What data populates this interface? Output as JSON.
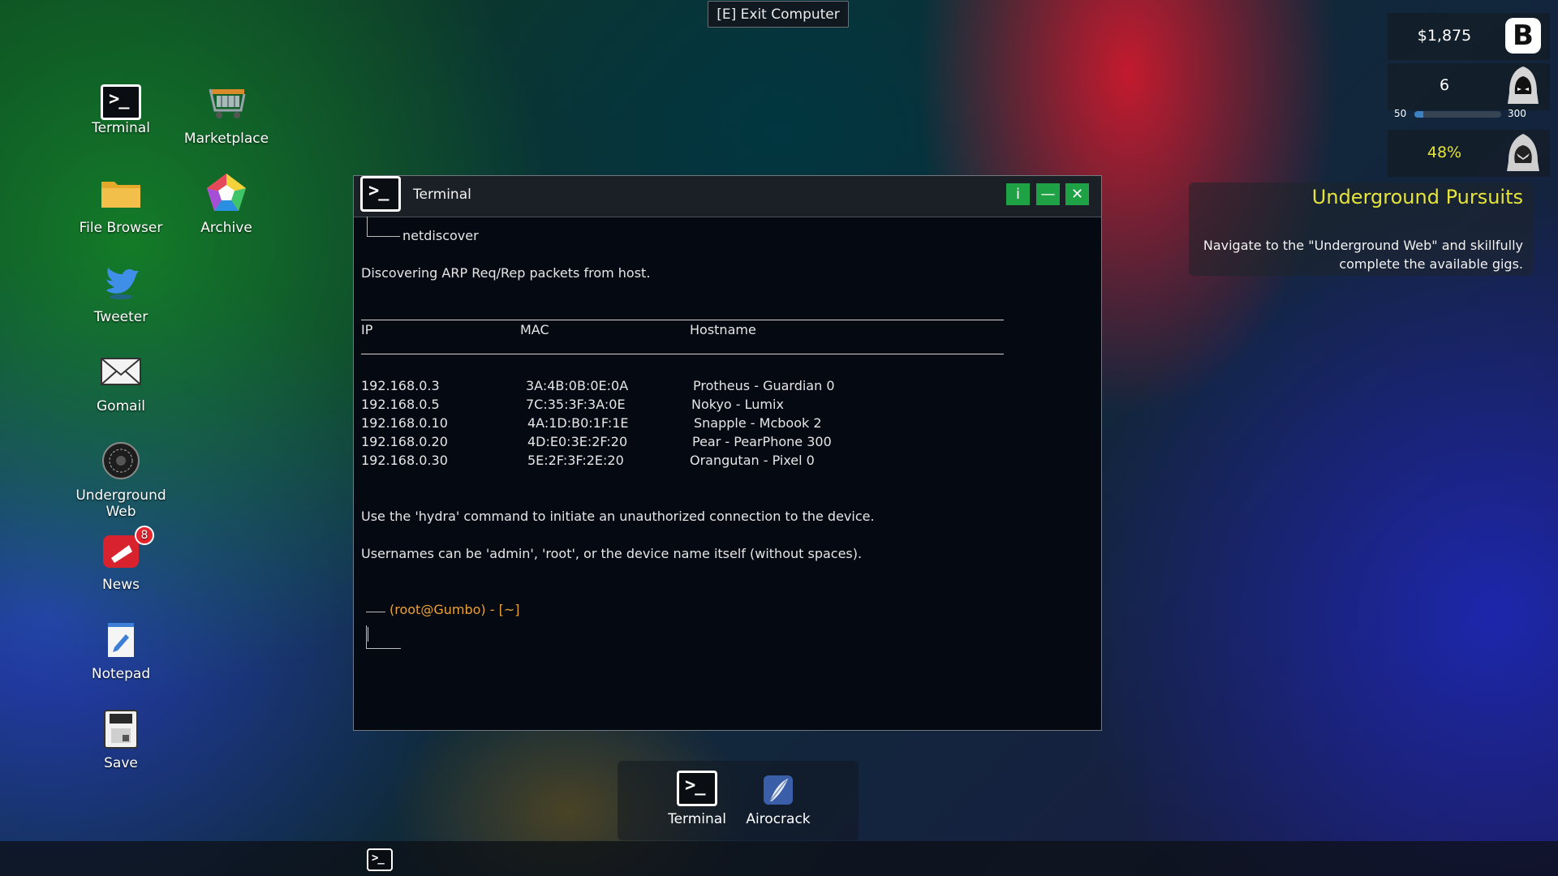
{
  "exit_hint": "[E] Exit Computer",
  "desktop": {
    "icons": [
      {
        "label": "Terminal"
      },
      {
        "label": "Marketplace"
      },
      {
        "label": "File Browser"
      },
      {
        "label": "Archive"
      },
      {
        "label": "Tweeter"
      },
      {
        "label": "Gomail"
      },
      {
        "label": "Underground Web"
      },
      {
        "label": "News",
        "badge": "8"
      },
      {
        "label": "Notepad"
      },
      {
        "label": "Save"
      }
    ]
  },
  "terminal_window": {
    "title": "Terminal",
    "buttons": {
      "info": "i",
      "minimize": "—",
      "close": "✕"
    },
    "command": "netdiscover",
    "discovering": "Discovering ARP Req/Rep packets from host.",
    "headers": {
      "ip": "IP",
      "mac": "MAC",
      "hostname": "Hostname"
    },
    "rows": [
      {
        "ip": "192.168.0.3",
        "mac": "3A:4B:0B:0E:0A",
        "hostname": "Protheus - Guardian 0"
      },
      {
        "ip": "192.168.0.5",
        "mac": "7C:35:3F:3A:0E",
        "hostname": "Nokyo - Lumix"
      },
      {
        "ip": "192.168.0.10",
        "mac": "4A:1D:B0:1F:1E",
        "hostname": "Snapple - Mcbook 2"
      },
      {
        "ip": "192.168.0.20",
        "mac": "4D:E0:3E:2F:20",
        "hostname": "Pear - PearPhone 300"
      },
      {
        "ip": "192.168.0.30",
        "mac": "5E:2F:3F:2E:20",
        "hostname": "Orangutan - Pixel 0"
      }
    ],
    "hint_hydra": "Use the 'hydra' command to initiate an unauthorized connection to the device.",
    "hint_usernames": "Usernames can be 'admin', 'root', or the device name itself (without spaces).",
    "prompt": "(root@Gumbo) - [~]"
  },
  "hud": {
    "money": "$1,875",
    "level": "6",
    "xp_min": "50",
    "xp_max": "300",
    "xp_progress_fraction": 0.1,
    "percent": "48%"
  },
  "quest": {
    "title": "Underground Pursuits",
    "description": "Navigate to the \"Underground Web\" and skillfully complete the available gigs."
  },
  "dock": {
    "items": [
      {
        "label": "Terminal"
      },
      {
        "label": "Airocrack"
      }
    ]
  },
  "colors": {
    "accent_green": "#1fa245",
    "prompt_orange": "#e9a33a",
    "quest_title": "#e6e43b"
  }
}
